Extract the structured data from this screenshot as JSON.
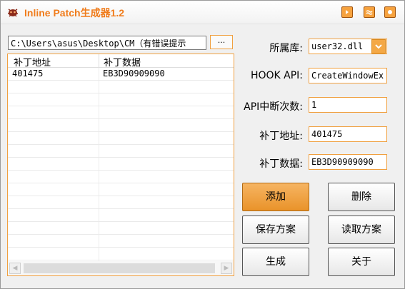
{
  "window": {
    "title": "Inline Patch生成器1.2"
  },
  "file": {
    "path": "C:\\Users\\asus\\Desktop\\CM（有错误提示",
    "browse_label": "..."
  },
  "table": {
    "columns": [
      "补丁地址",
      "补丁数据"
    ],
    "rows": [
      {
        "address": "401475",
        "data": "EB3D90909090"
      }
    ]
  },
  "form": {
    "library_label": "所属库:",
    "library_value": "user32.dll",
    "hook_api_label": "HOOK API:",
    "hook_api_value": "CreateWindowEx",
    "break_count_label": "API中断次数:",
    "break_count_value": "1",
    "patch_address_label": "补丁地址:",
    "patch_address_value": "401475",
    "patch_data_label": "补丁数据:",
    "patch_data_value": "EB3D90909090"
  },
  "buttons": {
    "add": "添加",
    "delete": "删除",
    "save_scheme": "保存方案",
    "load_scheme": "读取方案",
    "generate": "生成",
    "about": "关于"
  },
  "colors": {
    "accent": "#f07c1c",
    "button_primary": "#e9932a",
    "border_accent": "#f0a040"
  },
  "icons": {
    "app": "bug-icon",
    "title_buttons": [
      "help-icon",
      "minimize-icon",
      "close-icon"
    ]
  }
}
